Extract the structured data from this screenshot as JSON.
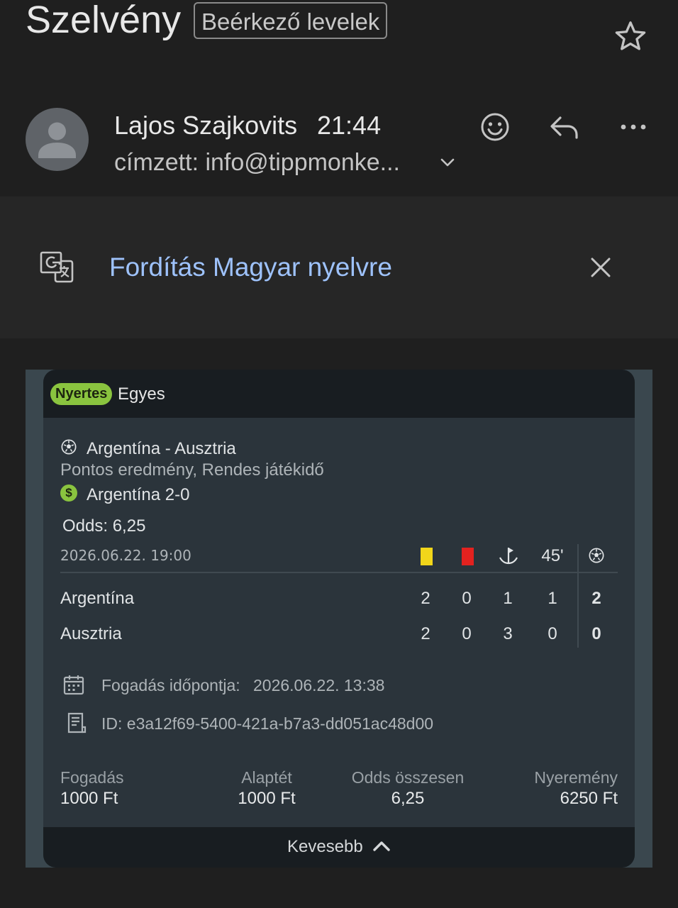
{
  "header": {
    "subject": "Szelvény",
    "folder_label": "Beérkező levelek",
    "star_icon": "star-outline-icon"
  },
  "message": {
    "sender": "Lajos Szajkovits",
    "time": "21:44",
    "recipient": "címzett: info@tippmonke...",
    "icons": [
      "emoji-icon",
      "reply-icon",
      "more-icon",
      "chevron-down-icon",
      "avatar-person-icon"
    ]
  },
  "translate": {
    "link": "Fordítás Magyar nyelvre",
    "icons": [
      "translate-icon",
      "close-icon"
    ]
  },
  "ticket": {
    "status_badge": "Nyertes",
    "bet_type": "Egyes",
    "match": "Argentína - Ausztria",
    "market": "Pontos eredmény, Rendes játékidő",
    "selection": "Argentína 2-0",
    "odds": "Odds: 6,25",
    "match_datetime": "2026.06.22. 19:00",
    "stats_headers": [
      "yellow-card",
      "red-card",
      "corner",
      "45'",
      "goal"
    ],
    "halftime_label": "45'",
    "teams": [
      {
        "name": "Argentína",
        "yellow": "2",
        "red": "0",
        "corners": "1",
        "halftime": "1",
        "goals": "2"
      },
      {
        "name": "Ausztria",
        "yellow": "2",
        "red": "0",
        "corners": "3",
        "halftime": "0",
        "goals": "0"
      }
    ],
    "placed_label": "Fogadás időpontja:",
    "placed_value": "2026.06.22. 13:38",
    "id_text": "ID: e3a12f69-5400-421a-b7a3-dd051ac48d00",
    "summary": {
      "stake_label": "Fogadás",
      "stake_value": "1000 Ft",
      "base_label": "Alaptét",
      "base_value": "1000 Ft",
      "odds_label": "Odds összesen",
      "odds_value": "6,25",
      "win_label": "Nyeremény",
      "win_value": "6250 Ft"
    },
    "less_label": "Kevesebb"
  },
  "colors": {
    "background": "#1f1f1f",
    "link": "#9ec2fb",
    "badge": "#8ac43f",
    "ticket_body": "#2b343b",
    "ticket_header": "#181d21",
    "yellow_card": "#f2d61a",
    "red_card": "#e3221f"
  }
}
